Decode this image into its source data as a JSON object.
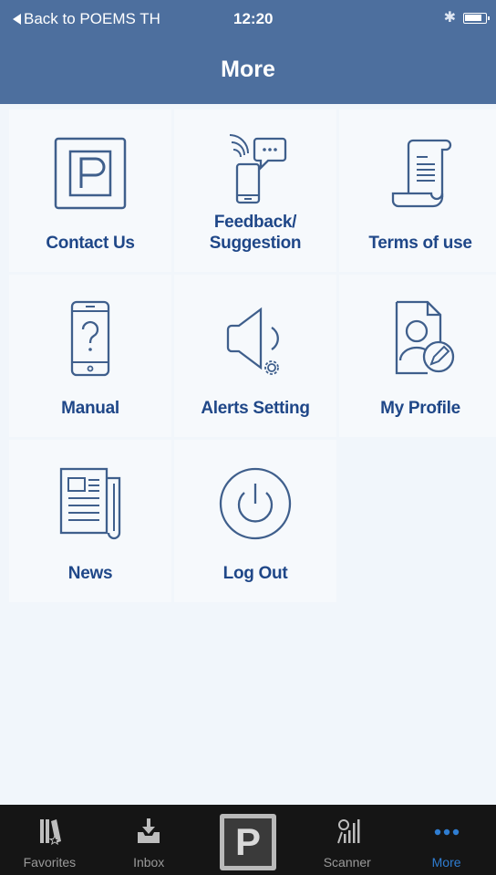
{
  "status_bar": {
    "back_label": "Back to POEMS TH",
    "time": "12:20",
    "bluetooth_icon": "bluetooth-icon",
    "battery_icon": "battery-icon"
  },
  "nav": {
    "title": "More"
  },
  "menu": {
    "contact": {
      "label": "Contact Us",
      "icon": "poems-logo-icon"
    },
    "feedback": {
      "line1": "Feedback/",
      "line2": "Suggestion",
      "icon": "phone-chat-icon"
    },
    "terms": {
      "label": "Terms of use",
      "icon": "scroll-document-icon"
    },
    "manual": {
      "label": "Manual",
      "icon": "phone-question-icon"
    },
    "alerts": {
      "label": "Alerts Setting",
      "icon": "speaker-gear-icon"
    },
    "profile": {
      "label": "My Profile",
      "icon": "profile-edit-icon"
    },
    "news": {
      "label": "News",
      "icon": "newspaper-icon"
    },
    "logout": {
      "label": "Log Out",
      "icon": "power-icon"
    }
  },
  "tab_bar": {
    "favorites": "Favorites",
    "inbox": "Inbox",
    "home_logo": "P",
    "scanner": "Scanner",
    "more": "More",
    "active_tab": "More"
  },
  "colors": {
    "header_bg": "#4d6f9e",
    "label_text": "#1f4788",
    "icon_stroke": "#3f5f8c",
    "tab_bar_bg": "#151515",
    "tab_active": "#2f7dd1"
  }
}
